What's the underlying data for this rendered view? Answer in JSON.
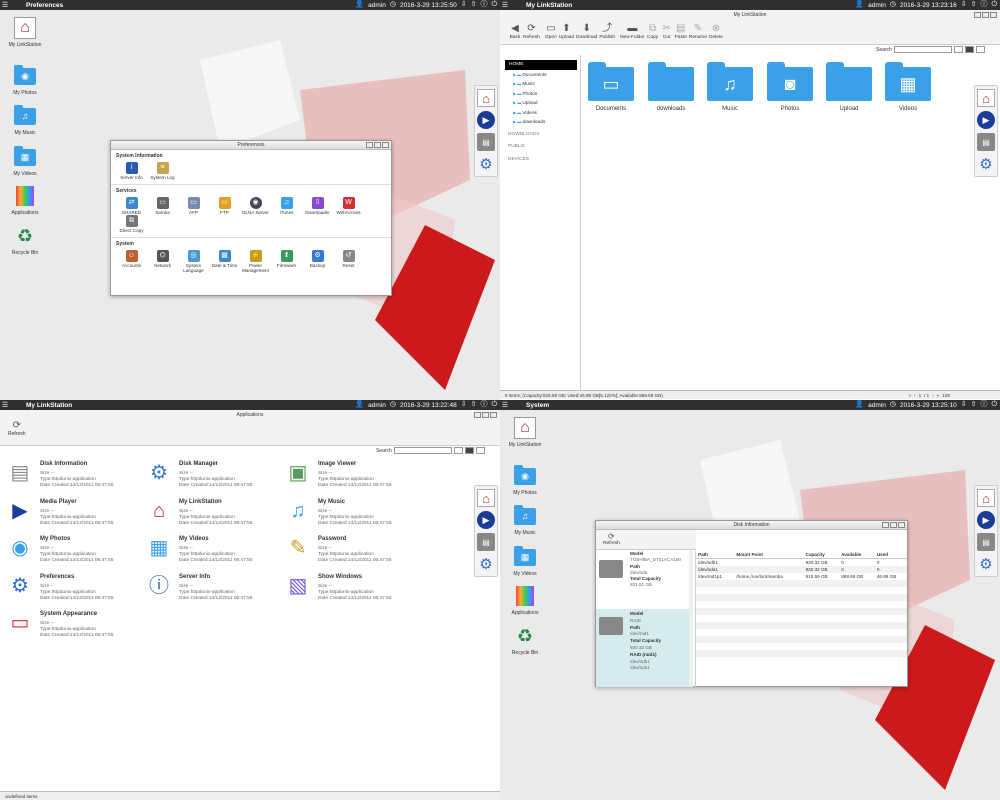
{
  "topbar": {
    "user": "admin",
    "datetime_1": "2016-3-29 13:25:50",
    "datetime_2": "2016-3-29 13:23:16",
    "datetime_3": "2016-3-29 13:22:48",
    "datetime_4": "2016-3-29 13:25:10"
  },
  "pane1": {
    "title": "Preferences"
  },
  "pane2": {
    "title": "My LinkStation"
  },
  "pane3": {
    "title": "My LinkStation"
  },
  "pane4": {
    "title": "System"
  },
  "desktop": {
    "items": [
      "My LinkStation",
      "My Photos",
      "My Music",
      "My Videos",
      "Applications",
      "Recycle Bin"
    ]
  },
  "preferences": {
    "window_title": "Preferences",
    "sections": [
      {
        "title": "System Information",
        "items": [
          "Server Info",
          "System Log"
        ]
      },
      {
        "title": "Services",
        "items": [
          "SHARED",
          "Samba",
          "AFP",
          "FTP",
          "DLNA Server",
          "iTunes",
          "Downloader",
          "WebAccess",
          "Direct Copy"
        ]
      },
      {
        "title": "System",
        "items": [
          "Accounts",
          "Network",
          "System Language",
          "Date & Time",
          "Power Management",
          "Firmware",
          "Backup",
          "Reset"
        ]
      }
    ]
  },
  "filebrowser": {
    "window_title": "My LinkStation",
    "toolbar": [
      "Back",
      "Refresh",
      "Open",
      "Upload",
      "Download",
      "Publish",
      "New Folder",
      "Copy",
      "Cut",
      "Paste",
      "Rename",
      "Delete"
    ],
    "search_label": "Search",
    "tree": {
      "root": "HOME",
      "children": [
        "Documents",
        "Music",
        "Photos",
        "Upload",
        "Videos",
        "downloads"
      ],
      "groups": [
        "DOWNLOADS",
        "PUBLIC",
        "DEVICES"
      ]
    },
    "folders": [
      "Documents",
      "downloads",
      "Music",
      "Photos",
      "Upload",
      "Videos"
    ],
    "status": "6 items; (Capacity:915.59 GB; Used:46.89 GB[5.122%]; Available:868.69 GB)",
    "pager": {
      "page": "1",
      "of": "/ 1",
      "per": "100"
    }
  },
  "applications": {
    "window_title": "Applications",
    "refresh": "Refresh",
    "search_label": "Search",
    "size_line": "Size --",
    "type_line": "Type:httpdunix-application",
    "date_line": "Date Created:14/12/2011 06:47:55",
    "apps": [
      "Disk Information",
      "Disk Manager",
      "Image Viewer",
      "Media Player",
      "My LinkStation",
      "My Music",
      "My Photos",
      "My Videos",
      "Password",
      "Preferences",
      "Server Info",
      "Show Windows",
      "System Appearance"
    ],
    "status": "undefined items"
  },
  "diskinfo": {
    "window_title": "Disk Information",
    "refresh": "Refresh",
    "disk1": {
      "l1": "Model",
      "v1": "TOSHIBA_DT01ACA100",
      "l2": "Path",
      "v2": "/dev/sda",
      "l3": "Total Capacity",
      "v3": "931.51 GB"
    },
    "disk2": {
      "l1": "Model",
      "v1": "RAID",
      "l2": "Path",
      "v2": "/dev/md1",
      "l3": "Total Capacity",
      "v3": "930.32 GB",
      "l4": "RAID (raid1)",
      "v4a": "/dev/sdb1",
      "v4b": "/dev/sda1"
    },
    "columns": [
      "Path",
      "Mount Point",
      "Capacity",
      "Available",
      "Used"
    ],
    "rows": [
      [
        "/dev/sdb1",
        "",
        "930.32 GB",
        "0",
        "0"
      ],
      [
        "/dev/sda1",
        "",
        "930.32 GB",
        "0",
        "0"
      ],
      [
        "/dev/md1p1",
        "/home,/run/lock/samba",
        "915.59 GB",
        "868.69 GB",
        "46.89 GB"
      ]
    ]
  }
}
